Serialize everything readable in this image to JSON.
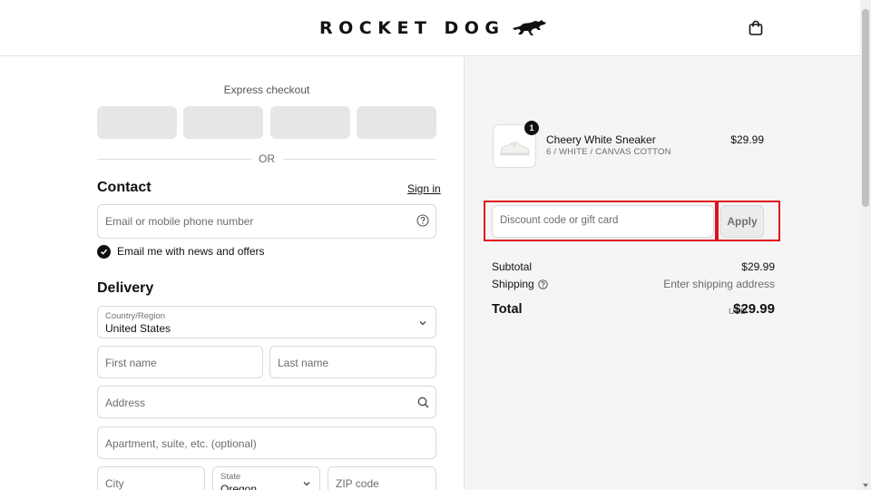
{
  "brand": {
    "name": "ROCKET DOG"
  },
  "express_checkout": {
    "label": "Express checkout",
    "or_text": "OR"
  },
  "contact": {
    "title": "Contact",
    "sign_in": "Sign in",
    "email_placeholder": "Email or mobile phone number",
    "newsletter_label": "Email me with news and offers",
    "newsletter_checked": true
  },
  "delivery": {
    "title": "Delivery",
    "country_label": "Country/Region",
    "country_value": "United States",
    "first_name_placeholder": "First name",
    "last_name_placeholder": "Last name",
    "address_placeholder": "Address",
    "apartment_placeholder": "Apartment, suite, etc. (optional)",
    "city_placeholder": "City",
    "state_label": "State",
    "state_value": "Oregon",
    "zip_placeholder": "ZIP code"
  },
  "order": {
    "item": {
      "quantity": "1",
      "name": "Cheery White Sneaker",
      "variant": "6 / WHITE / CANVAS COTTON",
      "price": "$29.99"
    },
    "discount_placeholder": "Discount code or gift card",
    "apply_label": "Apply",
    "subtotal_label": "Subtotal",
    "subtotal_value": "$29.99",
    "shipping_label": "Shipping",
    "shipping_value": "Enter shipping address",
    "total_label": "Total",
    "total_currency": "USD",
    "total_value": "$29.99"
  },
  "colors": {
    "highlight_outline": "#e0101e",
    "order_panel_bg": "#f5f5f5",
    "express_button_bg": "#e6e6e6"
  }
}
